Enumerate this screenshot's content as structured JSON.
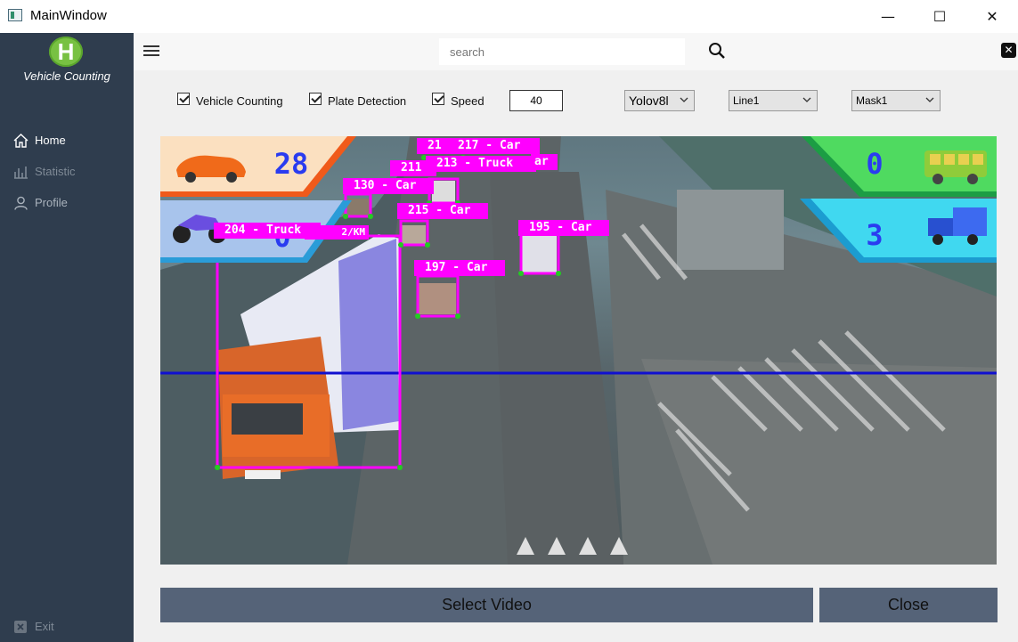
{
  "window": {
    "title": "MainWindow",
    "minimize": "—",
    "maximize": "☐",
    "close": "✕"
  },
  "sidebar": {
    "logo_letter": "H",
    "logo_text": "Vehicle Counting",
    "items": [
      {
        "label": "Home",
        "icon": "home-icon",
        "color": "#ffffff"
      },
      {
        "label": "Statistic",
        "icon": "statistic-icon",
        "color": "#7f8a96"
      },
      {
        "label": "Profile",
        "icon": "profile-icon",
        "color": "#aab3bd"
      }
    ],
    "exit_label": "Exit"
  },
  "topbar": {
    "search_placeholder": "search"
  },
  "controls": {
    "vehicle_counting": {
      "label": "Vehicle Counting",
      "checked": true
    },
    "plate_detection": {
      "label": "Plate Detection",
      "checked": true
    },
    "speed": {
      "label": "Speed",
      "checked": true
    },
    "speed_value": "40",
    "model_select": "Yolov8l",
    "line_select": "Line1",
    "mask_select": "Mask1"
  },
  "video": {
    "counts": {
      "car": "28",
      "motorbike": "0",
      "bus": "0",
      "truck": "3"
    },
    "detections": [
      {
        "label": "204 - Truck"
      },
      {
        "label": "130 - Car"
      },
      {
        "label": "215 - Car"
      },
      {
        "label": "197 - Car"
      },
      {
        "label": "195 - Car"
      },
      {
        "label": "213 - Truck"
      },
      {
        "label": "217 - Car"
      },
      {
        "label": "21"
      },
      {
        "label": "211"
      },
      {
        "label": "ar"
      },
      {
        "label": "2/KM"
      }
    ]
  },
  "buttons": {
    "select_video": "Select Video",
    "close": "Close"
  },
  "colors": {
    "sidebar": "#2f3d4e",
    "button": "#556378",
    "detection": "#ff00ff",
    "count_text": "#2a3cf0",
    "line": "#1010d0"
  }
}
